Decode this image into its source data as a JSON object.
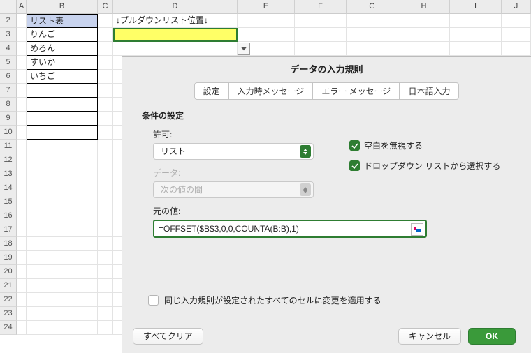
{
  "columns": [
    "A",
    "B",
    "C",
    "D",
    "E",
    "F",
    "G",
    "H",
    "I",
    "J"
  ],
  "rows_start": 2,
  "rows_count": 23,
  "cell_D2": "↓プルダウンリスト位置↓",
  "list_table": {
    "header": "リスト表",
    "items": [
      "りんご",
      "めろん",
      "すいか",
      "いちご",
      "",
      "",
      "",
      ""
    ]
  },
  "dialog": {
    "title": "データの入力規則",
    "tabs": [
      "設定",
      "入力時メッセージ",
      "エラー メッセージ",
      "日本語入力"
    ],
    "active_tab": 0,
    "section": "条件の設定",
    "allow_label": "許可:",
    "allow_value": "リスト",
    "data_label": "データ:",
    "data_value": "次の値の間",
    "ignore_blank": "空白を無視する",
    "dropdown_from_list": "ドロップダウン リストから選択する",
    "source_label": "元の値:",
    "source_value": "=OFFSET($B$3,0,0,COUNTA(B:B),1)",
    "apply_same": "同じ入力規則が設定されたすべてのセルに変更を適用する",
    "clear_all": "すべてクリア",
    "cancel": "キャンセル",
    "ok": "OK"
  }
}
